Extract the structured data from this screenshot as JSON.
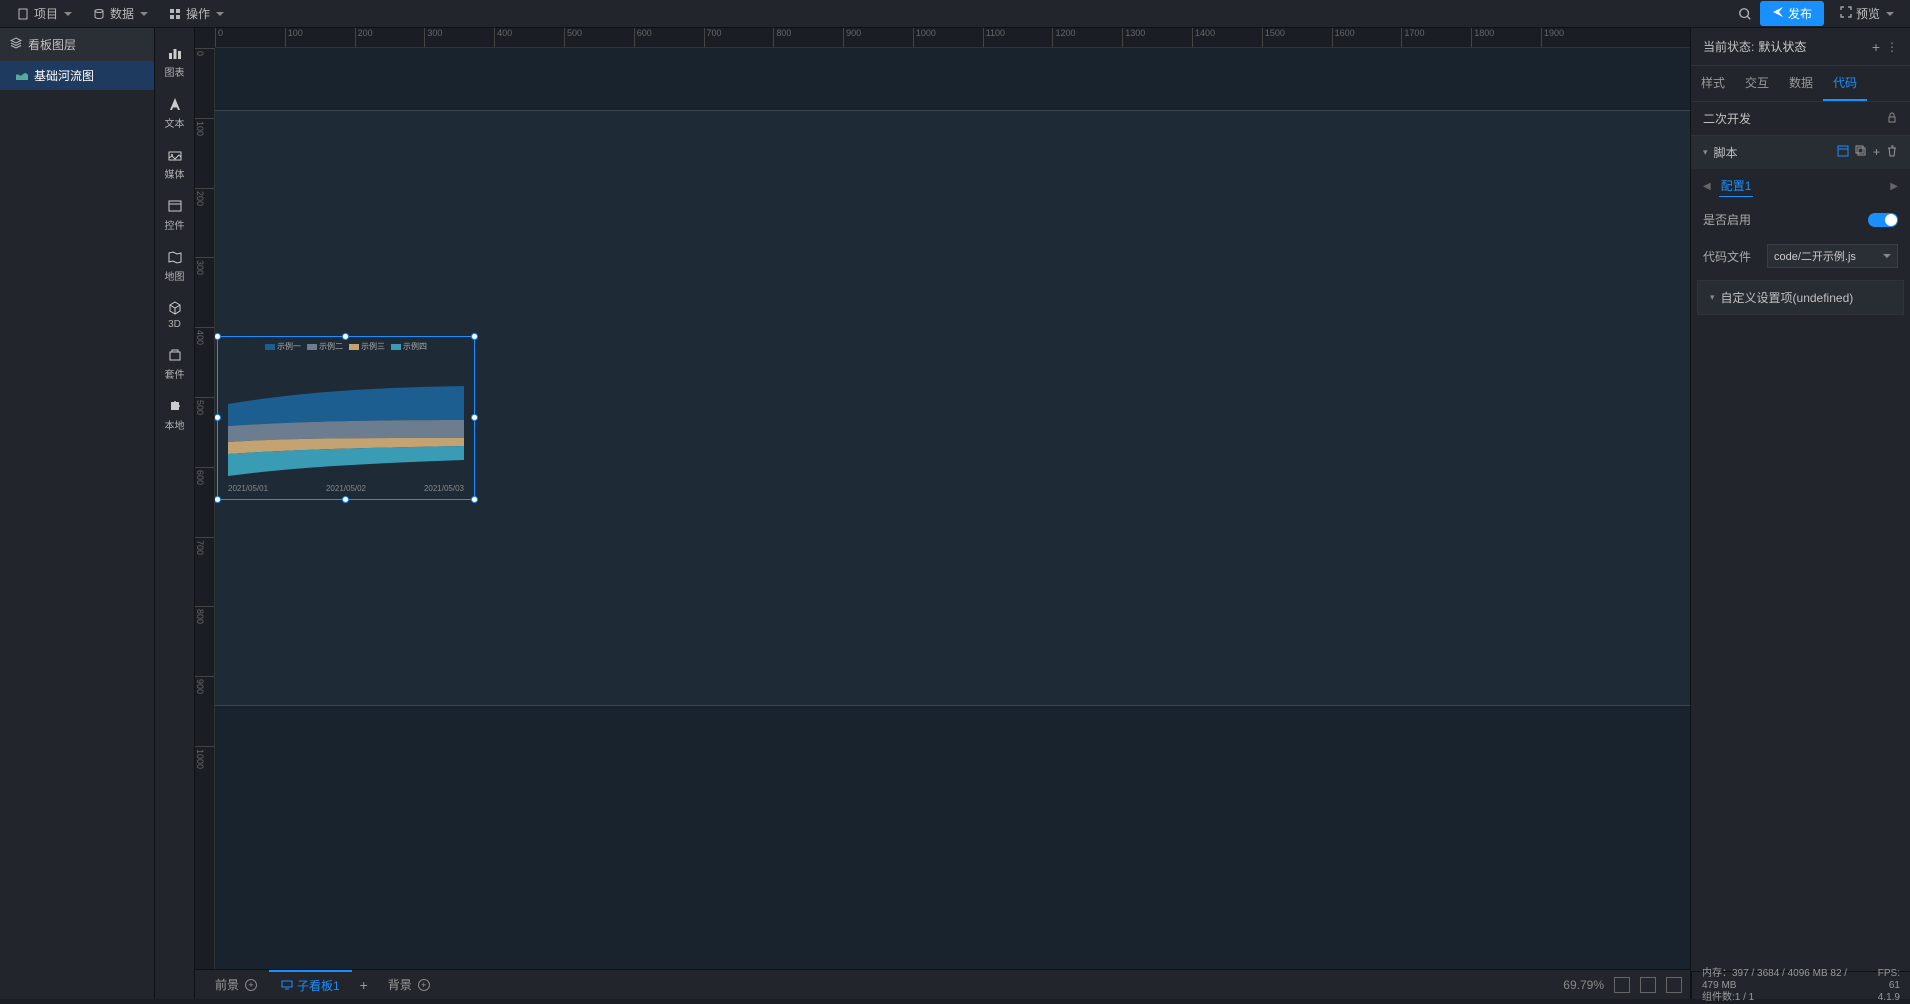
{
  "menubar": {
    "project": "项目",
    "data": "数据",
    "operation": "操作"
  },
  "topbar": {
    "publish": "发布",
    "preview": "预览"
  },
  "layers": {
    "title": "看板图层",
    "items": [
      "基础河流图"
    ]
  },
  "components": {
    "chart": "图表",
    "text": "文本",
    "media": "媒体",
    "control": "控件",
    "map": "地图",
    "threeD": "3D",
    "suite": "套件",
    "local": "本地"
  },
  "ruler_h": [
    0,
    100,
    200,
    300,
    400,
    500,
    600,
    700,
    800,
    900,
    1000,
    1100,
    1200,
    1300,
    1400,
    1500,
    1600,
    1700,
    1800,
    1900
  ],
  "ruler_v": [
    0,
    100,
    200,
    300,
    400,
    500,
    600,
    700,
    800,
    900,
    1000
  ],
  "bottom": {
    "foreground": "前景",
    "subpanel": "子看板1",
    "background": "背景",
    "zoom": "69.79%"
  },
  "right": {
    "state_label": "当前状态:",
    "state_value": "默认状态",
    "tabs": {
      "style": "样式",
      "interact": "交互",
      "data": "数据",
      "code": "代码"
    },
    "dev_section": "二次开发",
    "script_section": "脚本",
    "script_tab": "配置1",
    "enable_label": "是否启用",
    "codefile_label": "代码文件",
    "codefile_value": "code/二开示例.js",
    "custom_settings": "自定义设置项(undefined)"
  },
  "status": {
    "memory_label": "内存：",
    "memory_value": "397 / 3684 / 4096 MB  82 / 479 MB",
    "components_label": "组件数:",
    "components_value": "1 / 1",
    "fps_label": "FPS:",
    "fps_value": "61",
    "version": "4.1.9"
  },
  "chart_data": {
    "type": "area",
    "title": "",
    "categories": [
      "2021/05/01",
      "2021/05/02",
      "2021/05/03"
    ],
    "series": [
      {
        "name": "示例一",
        "color": "#1b5e8f",
        "values": [
          22,
          30,
          34
        ]
      },
      {
        "name": "示例二",
        "color": "#6b7d8e",
        "values": [
          18,
          18,
          18
        ]
      },
      {
        "name": "示例三",
        "color": "#c4a373",
        "values": [
          14,
          10,
          8
        ]
      },
      {
        "name": "示例四",
        "color": "#3a9bb5",
        "values": [
          26,
          18,
          14
        ]
      }
    ],
    "xlabel": "",
    "ylabel": ""
  }
}
